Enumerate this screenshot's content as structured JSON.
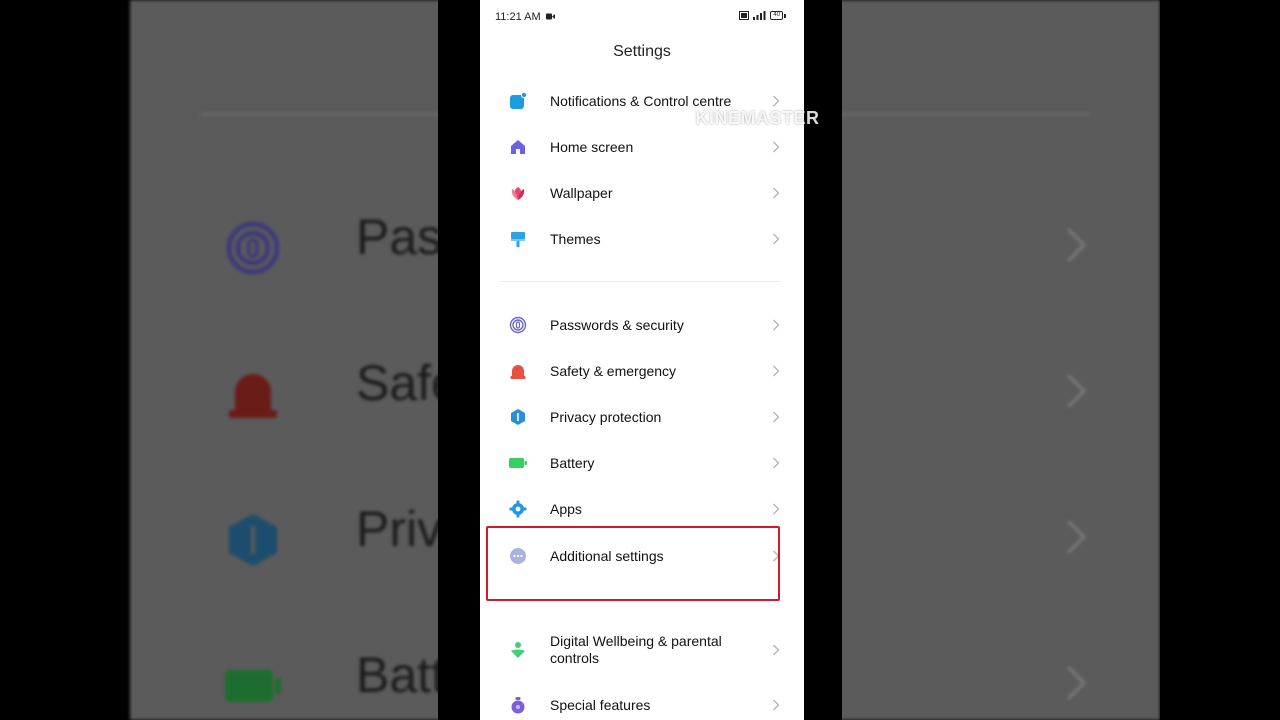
{
  "status_bar": {
    "time": "11:21 AM",
    "battery": "40"
  },
  "header": {
    "title": "Settings"
  },
  "group1": [
    {
      "label": "Notifications & Control centre",
      "icon": "notifications-icon"
    },
    {
      "label": "Home screen",
      "icon": "home-icon"
    },
    {
      "label": "Wallpaper",
      "icon": "wallpaper-icon"
    },
    {
      "label": "Themes",
      "icon": "themes-icon"
    }
  ],
  "group2": [
    {
      "label": "Passwords & security",
      "icon": "fingerprint-icon"
    },
    {
      "label": "Safety & emergency",
      "icon": "siren-icon"
    },
    {
      "label": "Privacy protection",
      "icon": "privacy-icon"
    },
    {
      "label": "Battery",
      "icon": "battery-icon"
    },
    {
      "label": "Apps",
      "icon": "gear-icon"
    },
    {
      "label": "Additional settings",
      "icon": "more-icon"
    }
  ],
  "group3": [
    {
      "label": "Digital Wellbeing & parental controls",
      "icon": "wellbeing-icon"
    },
    {
      "label": "Special features",
      "icon": "special-features-icon"
    }
  ],
  "background": {
    "rows": [
      "Pass",
      "Safe",
      "Priv",
      "Batt"
    ]
  },
  "watermark": {
    "text": "KINEMASTER"
  },
  "colors": {
    "highlight": "#d21b2a",
    "background_panel": "#5b5b5b"
  }
}
